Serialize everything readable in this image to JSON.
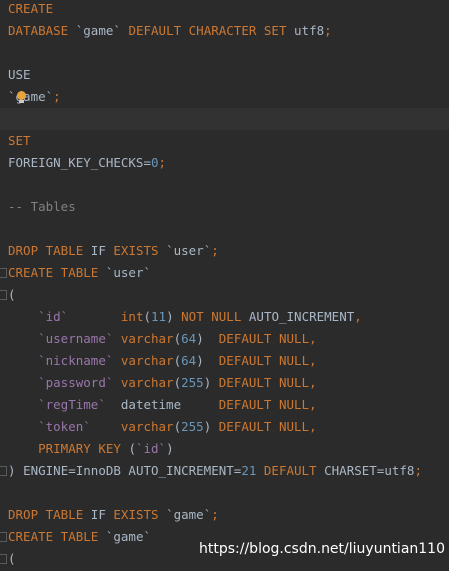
{
  "code": {
    "l1": {
      "kw": "CREATE"
    },
    "l2": {
      "kw1": "DATABASE",
      "name": "`game`",
      "kw2": "DEFAULT CHARACTER SET",
      "val": "utf8",
      "semi": ";"
    },
    "l4": {
      "kw": "USE"
    },
    "l5": {
      "name": "`game`",
      "semi": ";"
    },
    "l7": {
      "kw": "SET"
    },
    "l8": {
      "stmt": "FOREIGN_KEY_CHECKS=",
      "num": "0",
      "semi": ";"
    },
    "l10": {
      "comment": "-- Tables"
    },
    "l12": {
      "kw1": "DROP TABLE",
      "kw2": "IF",
      "kw3": "EXISTS",
      "name": "`user`",
      "semi": ";"
    },
    "l13": {
      "kw": "CREATE TABLE",
      "name": "`user`"
    },
    "l14": {
      "paren": "("
    },
    "columns": [
      {
        "name": "`id`",
        "type": "int",
        "len": "11",
        "rest_kw": "NOT NULL",
        "rest_id": "AUTO_INCREMENT",
        "end": ","
      },
      {
        "name": "`username`",
        "type": "varchar",
        "len": "64",
        "rest_kw": "DEFAULT NULL",
        "rest_id": "",
        "end": ","
      },
      {
        "name": "`nickname`",
        "type": "varchar",
        "len": "64",
        "rest_kw": "DEFAULT NULL",
        "rest_id": "",
        "end": ","
      },
      {
        "name": "`password`",
        "type": "varchar",
        "len": "255",
        "rest_kw": "DEFAULT NULL",
        "rest_id": "",
        "end": ","
      },
      {
        "name": "`regTime`",
        "type": "datetime",
        "len": "",
        "rest_kw": "DEFAULT NULL",
        "rest_id": "",
        "end": ","
      },
      {
        "name": "`token`",
        "type": "varchar",
        "len": "255",
        "rest_kw": "DEFAULT NULL",
        "rest_id": "",
        "end": ","
      }
    ],
    "l21": {
      "kw": "PRIMARY KEY",
      "name": "`id`"
    },
    "l22": {
      "close": ")",
      "engine": "ENGINE=InnoDB AUTO_INCREMENT=",
      "num": "21",
      "kw": "DEFAULT",
      "charset": "CHARSET=utf8",
      "semi": ";"
    },
    "l24": {
      "kw1": "DROP TABLE",
      "kw2": "IF",
      "kw3": "EXISTS",
      "name": "`game`",
      "semi": ";"
    },
    "l25": {
      "kw": "CREATE TABLE",
      "name": "`game`"
    },
    "l26": {
      "paren": "("
    }
  },
  "watermark": "https://blog.csdn.net/liuyuntian110",
  "colors": {
    "background": "#2b2b2b",
    "keyword": "#cc7832",
    "identifier": "#a9b7c6",
    "column_name": "#9876aa",
    "number": "#6897bb",
    "comment": "#808080",
    "current_line": "#323232"
  },
  "icons": [
    "intention-bulb-icon",
    "fold-marker-icon"
  ]
}
